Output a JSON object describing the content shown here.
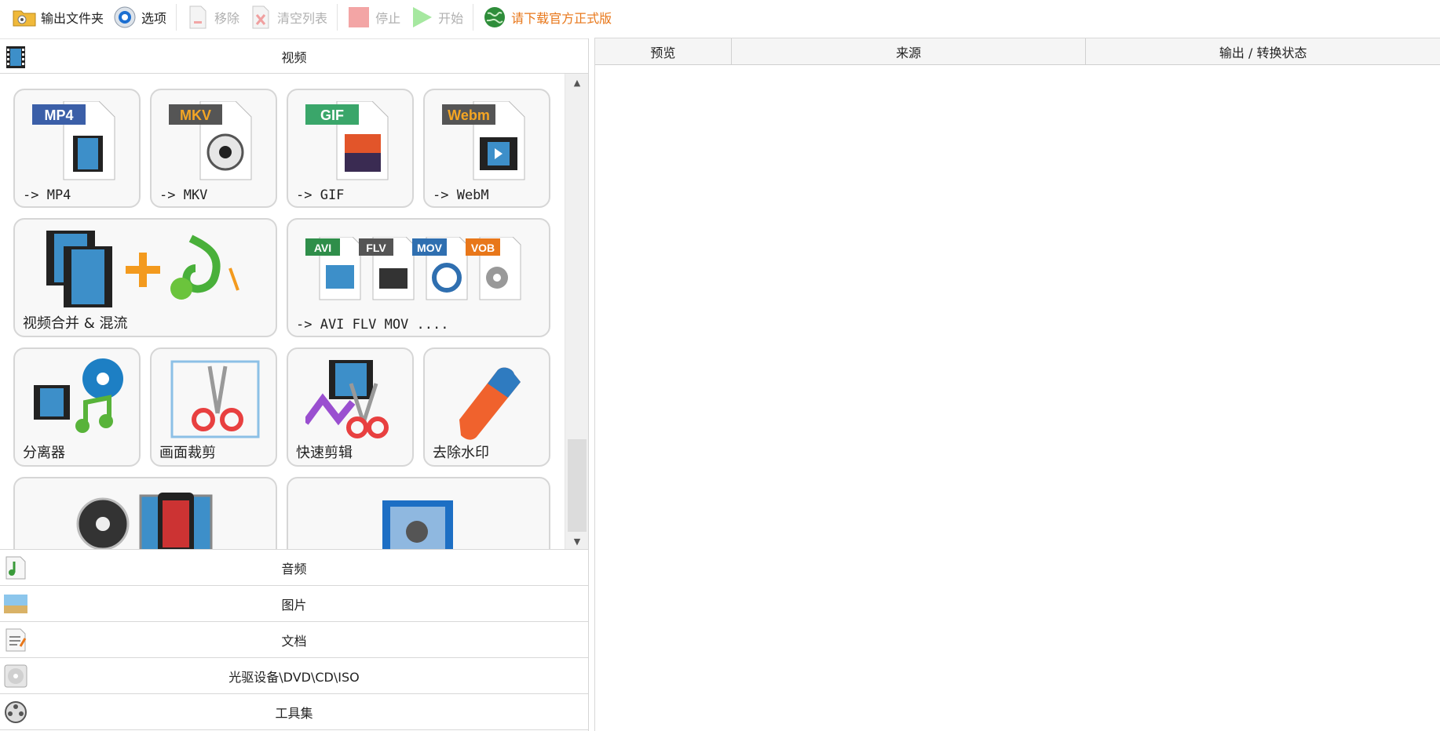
{
  "toolbar": {
    "output_folder": "输出文件夹",
    "options": "选项",
    "remove": "移除",
    "clear_list": "清空列表",
    "stop": "停止",
    "start": "开始",
    "download_promo": "请下载官方正式版"
  },
  "left": {
    "video_header": "视频",
    "tiles": {
      "mp4": {
        "badge": "MP4",
        "label": "-> MP4"
      },
      "mkv": {
        "badge": "MKV",
        "label": "-> MKV"
      },
      "gif": {
        "badge": "GIF",
        "label": "-> GIF"
      },
      "webm": {
        "badge": "Webm",
        "label": "-> WebM"
      },
      "merge": {
        "label": "视频合并 & 混流"
      },
      "others": {
        "badges": [
          "AVI",
          "FLV",
          "MOV",
          "VOB"
        ],
        "label": "-> AVI FLV MOV ...."
      },
      "splitter": {
        "label": "分离器"
      },
      "crop": {
        "label": "画面裁剪"
      },
      "quickcut": {
        "label": "快速剪辑"
      },
      "watermark": {
        "label": "去除水印"
      }
    },
    "categories": {
      "audio": "音频",
      "image": "图片",
      "document": "文档",
      "optical": "光驱设备\\DVD\\CD\\ISO",
      "tools": "工具集"
    }
  },
  "right": {
    "columns": {
      "preview": "预览",
      "source": "来源",
      "status": "输出 / 转换状态"
    }
  },
  "colors": {
    "promo": "#e8771a",
    "disabled": "#b0b0b0",
    "mp4": "#3b5fa8",
    "mkv": "#555555",
    "gif": "#3aa66a",
    "webm": "#555555"
  }
}
